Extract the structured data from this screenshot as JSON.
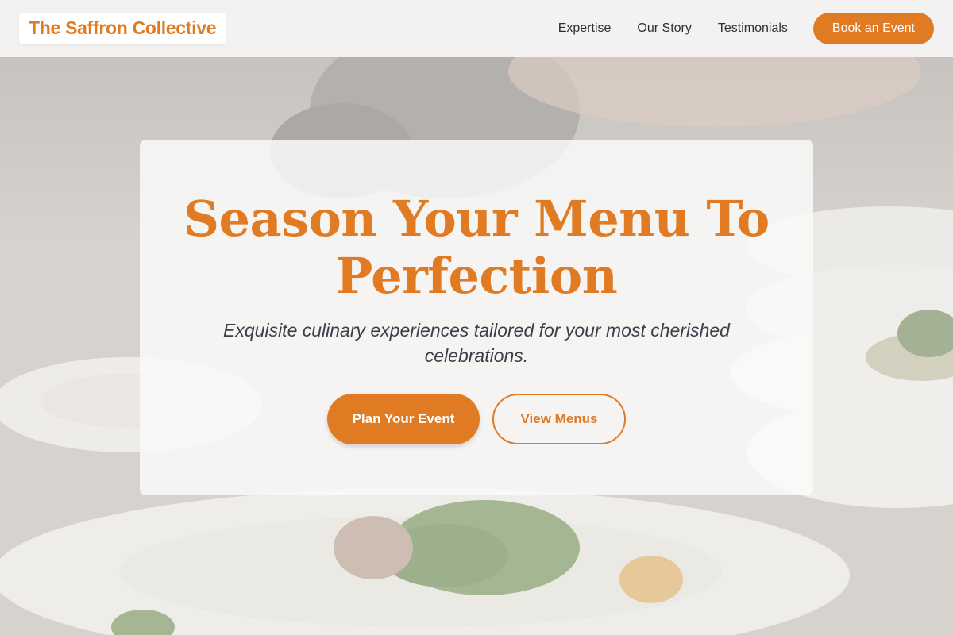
{
  "brand": {
    "name": "The Saffron Collective"
  },
  "nav": {
    "links": [
      {
        "label": "Expertise"
      },
      {
        "label": "Our Story"
      },
      {
        "label": "Testimonials"
      }
    ],
    "cta_label": "Book an Event"
  },
  "hero": {
    "title_line1": "Season Your Menu To",
    "title_line2": "Perfection",
    "subtitle": "Exquisite culinary experiences tailored for your most cherished celebrations.",
    "primary_label": "Plan Your Event",
    "secondary_label": "View Menus"
  },
  "colors": {
    "accent": "#e07b24",
    "text_dark": "#2e2e2e",
    "subtitle": "#3a3f4a"
  }
}
